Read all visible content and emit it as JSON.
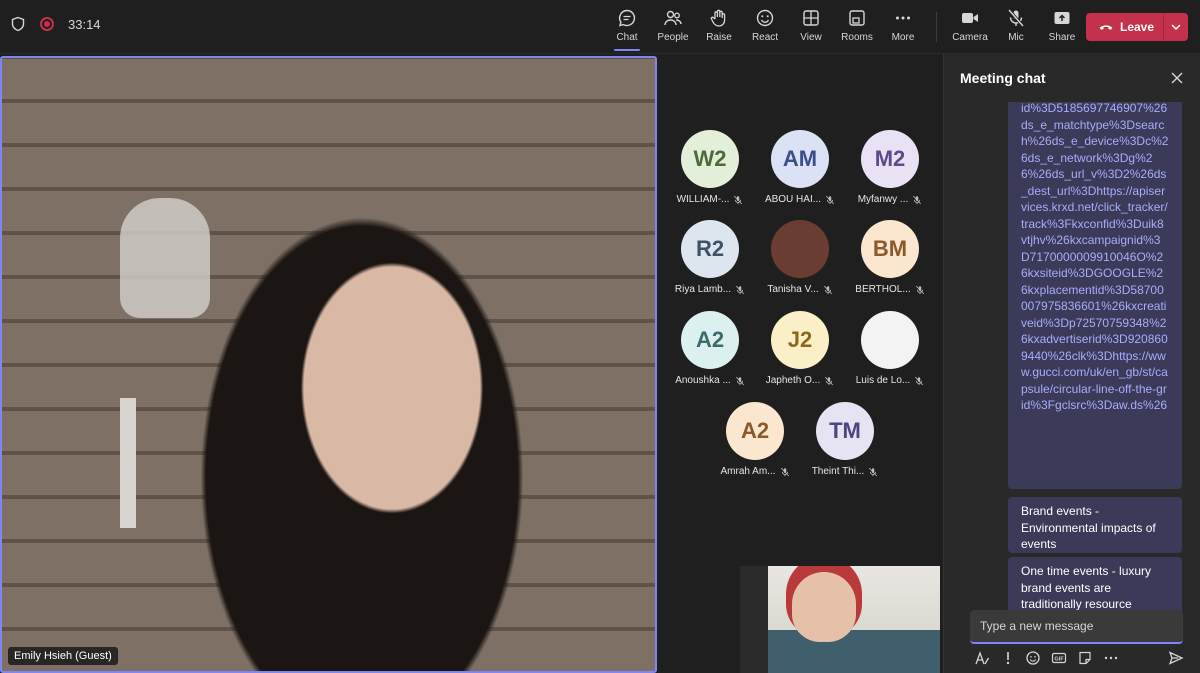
{
  "header": {
    "timer": "33:14",
    "tools": [
      {
        "label": "Chat",
        "icon": "chat-icon"
      },
      {
        "label": "People",
        "icon": "people-icon"
      },
      {
        "label": "Raise",
        "icon": "raise-hand-icon"
      },
      {
        "label": "React",
        "icon": "smiley-icon"
      },
      {
        "label": "View",
        "icon": "grid-view-icon"
      },
      {
        "label": "Rooms",
        "icon": "rooms-icon"
      },
      {
        "label": "More",
        "icon": "more-icon"
      }
    ],
    "devices": [
      {
        "label": "Camera",
        "icon": "camera-icon"
      },
      {
        "label": "Mic",
        "icon": "mic-off-icon"
      },
      {
        "label": "Share",
        "icon": "share-icon"
      }
    ],
    "leave_label": "Leave",
    "accent": "#7f85f5",
    "leave_color": "#c4314b"
  },
  "stage": {
    "speaker_name": "Emily Hsieh (Guest)"
  },
  "participants": [
    {
      "initials": "W2",
      "name": "WILLIAM-...",
      "bg": "#e3efd9",
      "fg": "#4d6b3b"
    },
    {
      "initials": "AM",
      "name": "ABOU HAI...",
      "bg": "#dbe2f6",
      "fg": "#3b4f8a"
    },
    {
      "initials": "M2",
      "name": "Myfanwy ...",
      "bg": "#e9e2f5",
      "fg": "#5e4a86"
    },
    {
      "initials": "R2",
      "name": "Riya Lamb...",
      "bg": "#dde6ee",
      "fg": "#3c5366"
    },
    {
      "initials": "",
      "name": "Tanisha V...",
      "bg": "#6b3d32",
      "fg": "#fff"
    },
    {
      "initials": "BM",
      "name": "BERTHOL...",
      "bg": "#fbe6cf",
      "fg": "#8a5a2a"
    },
    {
      "initials": "A2",
      "name": "Anoushka ...",
      "bg": "#dcf0f0",
      "fg": "#3b6b6b"
    },
    {
      "initials": "J2",
      "name": "Japheth O...",
      "bg": "#fbefc8",
      "fg": "#8a6a1a"
    },
    {
      "initials": "",
      "name": "Luis de Lo...",
      "bg": "#f3f3f3",
      "fg": "#333"
    },
    {
      "initials": "A2",
      "name": "Amrah Am...",
      "bg": "#fbe6cf",
      "fg": "#8a5a2a"
    },
    {
      "initials": "TM",
      "name": "Theint Thi...",
      "bg": "#e6e3f3",
      "fg": "#4a4680"
    }
  ],
  "chat": {
    "title": "Meeting chat",
    "link_text": "id%3D5185697746907%26ds_e_matchtype%3Dsearch%26ds_e_device%3Dc%26ds_e_network%3Dg%26%26ds_url_v%3D2%26ds_dest_url%3Dhttps://apiservices.krxd.net/click_tracker/track%3Fkxconfid%3Duik8vtjhv%26kxcampaignid%3D7170000009910046O%26kxsiteid%3DGOOGLE%26kxplacementid%3D58700007975836601%26kxcreativeid%3Dp72570759348%26kxadvertiserid%3D9208609440%26clk%3Dhttps://www.gucci.com/uk/en_gb/st/capsule/circular-line-off-the-grid%3Fgclsrc%3Daw.ds%26",
    "messages": [
      "Brand events - Environmental impacts of events",
      "One time events - luxury brand events are traditionally resource intensive"
    ],
    "compose_placeholder": "Type a new message"
  }
}
